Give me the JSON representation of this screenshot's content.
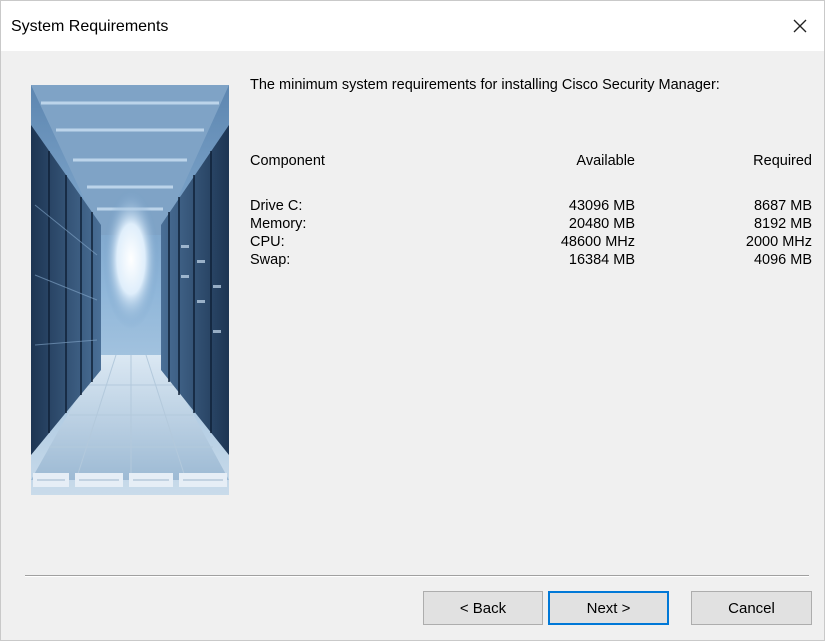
{
  "window": {
    "title": "System Requirements",
    "close_icon": "close-icon"
  },
  "content": {
    "intro": "The minimum system requirements for installing Cisco Security Manager:",
    "hero_image": "server-room-image",
    "headers": {
      "component": "Component",
      "available": "Available",
      "required": "Required"
    },
    "rows": [
      {
        "component": "Drive C:",
        "available": "43096 MB",
        "required": "8687 MB"
      },
      {
        "component": "Memory:",
        "available": "20480 MB",
        "required": "8192 MB"
      },
      {
        "component": "CPU:",
        "available": "48600 MHz",
        "required": "2000 MHz"
      },
      {
        "component": "Swap:",
        "available": "16384 MB",
        "required": "4096 MB"
      }
    ]
  },
  "buttons": {
    "back": "< Back",
    "next": "Next >",
    "cancel": "Cancel"
  },
  "colors": {
    "dialog_bg": "#f0f0f0",
    "button_bg": "#e1e1e1",
    "default_button_border": "#0078d7"
  }
}
